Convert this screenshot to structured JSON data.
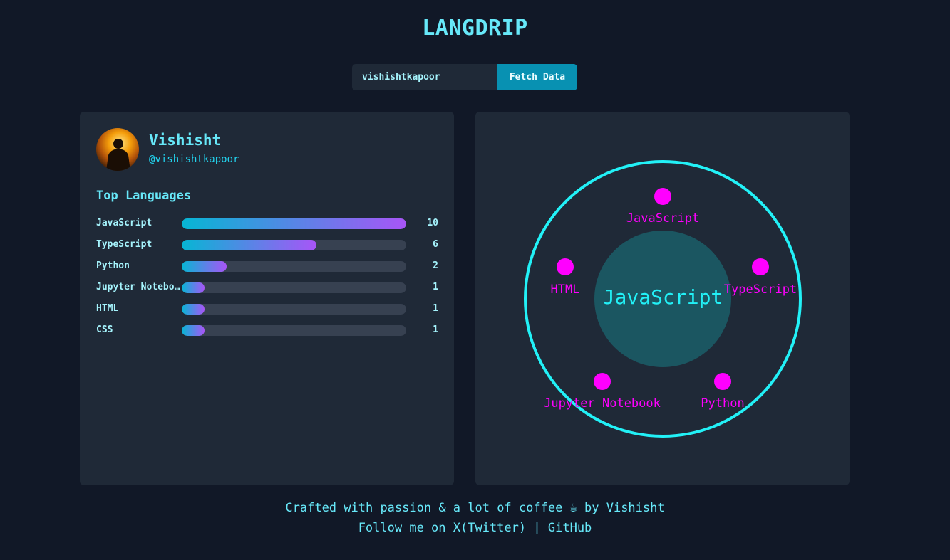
{
  "app": {
    "title": "LANGDRIP"
  },
  "search": {
    "value": "vishishtkapoor",
    "button_label": "Fetch Data"
  },
  "profile": {
    "name": "Vishisht",
    "handle": "@vishishtkapoor"
  },
  "languages": {
    "title": "Top Languages",
    "max": 10,
    "items": [
      {
        "name": "JavaScript",
        "count": 10
      },
      {
        "name": "TypeScript",
        "count": 6
      },
      {
        "name": "Python",
        "count": 2
      },
      {
        "name": "Jupyter Notebook",
        "count": 1
      },
      {
        "name": "HTML",
        "count": 1
      },
      {
        "name": "CSS",
        "count": 1
      }
    ]
  },
  "orbit": {
    "center_label": "JavaScript",
    "nodes": [
      "JavaScript",
      "TypeScript",
      "Python",
      "Jupyter Notebook",
      "HTML"
    ],
    "colors": {
      "ring": "#22f1f7",
      "node": "#ff00ff",
      "center_fill": "#1b5661",
      "center_text": "#22f1f7"
    }
  },
  "footer": {
    "line1": "Crafted with passion & a lot of coffee ☕ by Vishisht",
    "follow_text": "Follow me on",
    "twitter_label": "X(Twitter)",
    "separator": "|",
    "github_label": "GitHub"
  }
}
